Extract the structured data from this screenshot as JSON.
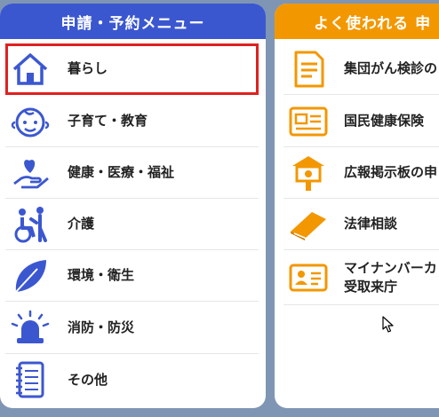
{
  "left_menu": {
    "title": "申請・予約メニュー",
    "items": [
      {
        "label": "暮らし",
        "icon": "house-icon"
      },
      {
        "label": "子育て・教育",
        "icon": "baby-face-icon"
      },
      {
        "label": "健康・医療・福祉",
        "icon": "hand-heart-icon"
      },
      {
        "label": "介護",
        "icon": "wheelchair-care-icon"
      },
      {
        "label": "環境・衛生",
        "icon": "leaf-icon"
      },
      {
        "label": "消防・防災",
        "icon": "siren-icon"
      },
      {
        "label": "その他",
        "icon": "notebook-icon"
      }
    ]
  },
  "right_menu": {
    "title": "よく使われる 申",
    "items": [
      {
        "label": "集団がん検診の",
        "icon": "document-icon"
      },
      {
        "label": "国民健康保険",
        "icon": "id-card-icon"
      },
      {
        "label": "広報掲示板の申",
        "icon": "bulletin-board-icon"
      },
      {
        "label": "法律相談",
        "icon": "book-icon"
      },
      {
        "label": "マイナンバーカ\n受取来庁",
        "line1": "マイナンバーカ",
        "line2": "受取来庁",
        "icon": "mynumber-card-icon"
      }
    ]
  },
  "colors": {
    "left_header": "#3b57d0",
    "right_header": "#f39700",
    "left_icon": "#3b57d0",
    "right_icon": "#f39700",
    "selected_outline": "#e02020"
  }
}
